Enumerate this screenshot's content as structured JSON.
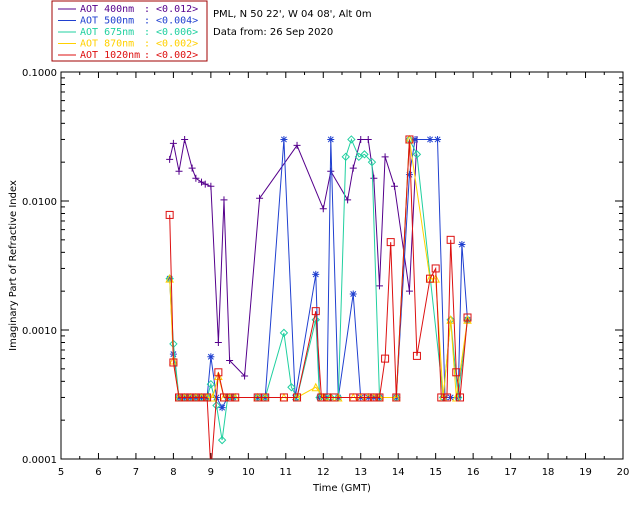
{
  "chart_data": {
    "type": "line",
    "header": {
      "site": "PML, N 50 22', W 04 08', Alt 0m",
      "date": "Data from: 26 Sep 2020"
    },
    "xlabel": "Time (GMT)",
    "ylabel": "Imaginary Part of Refractive Index",
    "x_range": [
      5,
      20
    ],
    "x_ticks": [
      "5",
      "6",
      "7",
      "8",
      "9",
      "10",
      "11",
      "12",
      "13",
      "14",
      "15",
      "16",
      "17",
      "18",
      "19",
      "20"
    ],
    "y_scale": "log",
    "y_range": [
      0.0001,
      0.1
    ],
    "y_ticks": [
      "0.1000",
      "0.0100",
      "0.0010",
      "0.0001"
    ],
    "y_tick_values": [
      0.1,
      0.01,
      0.001,
      0.0001
    ],
    "legend_position": "top-left",
    "series": [
      {
        "name": "AOT 400nm",
        "stat": ": <0.012>",
        "color": "#55008c",
        "marker": "plus",
        "points": [
          [
            7.9,
            0.021
          ],
          [
            8.0,
            0.028
          ],
          [
            8.15,
            0.017
          ],
          [
            8.3,
            0.03
          ],
          [
            8.5,
            0.018
          ],
          [
            8.6,
            0.015
          ],
          [
            8.75,
            0.014
          ],
          [
            8.85,
            0.0135
          ],
          [
            9.0,
            0.013
          ],
          [
            9.2,
            0.0008
          ],
          [
            9.35,
            0.0102
          ],
          [
            9.5,
            0.00058
          ],
          [
            9.9,
            0.00044
          ],
          [
            10.3,
            0.0105
          ],
          [
            11.3,
            0.027
          ],
          [
            12.0,
            0.0087
          ],
          [
            12.2,
            0.017
          ],
          [
            12.65,
            0.0102
          ],
          [
            12.8,
            0.018
          ],
          [
            13.0,
            0.03
          ],
          [
            13.2,
            0.03
          ],
          [
            13.35,
            0.015
          ],
          [
            13.5,
            0.0022
          ],
          [
            13.65,
            0.022
          ],
          [
            13.9,
            0.013
          ],
          [
            14.3,
            0.002
          ],
          [
            14.5,
            0.03
          ]
        ]
      },
      {
        "name": "AOT 500nm",
        "stat": ": <0.004>",
        "color": "#2040d0",
        "marker": "star",
        "points": [
          [
            7.9,
            0.0025
          ],
          [
            8.0,
            0.00065
          ],
          [
            8.15,
            0.0003
          ],
          [
            8.3,
            0.0003
          ],
          [
            8.45,
            0.0003
          ],
          [
            8.6,
            0.0003
          ],
          [
            8.75,
            0.0003
          ],
          [
            8.9,
            0.0003
          ],
          [
            9.0,
            0.00062
          ],
          [
            9.15,
            0.0003
          ],
          [
            9.3,
            0.00025
          ],
          [
            9.45,
            0.0003
          ],
          [
            9.6,
            0.0003
          ],
          [
            10.25,
            0.0003
          ],
          [
            10.45,
            0.0003
          ],
          [
            10.95,
            0.03
          ],
          [
            11.25,
            0.0003
          ],
          [
            11.8,
            0.0027
          ],
          [
            11.9,
            0.0003
          ],
          [
            12.1,
            0.0003
          ],
          [
            12.2,
            0.03
          ],
          [
            12.4,
            0.0003
          ],
          [
            12.8,
            0.0019
          ],
          [
            13.0,
            0.0003
          ],
          [
            13.2,
            0.0003
          ],
          [
            13.35,
            0.0003
          ],
          [
            13.5,
            0.0003
          ],
          [
            13.95,
            0.0003
          ],
          [
            14.3,
            0.016
          ],
          [
            14.45,
            0.03
          ],
          [
            14.85,
            0.03
          ],
          [
            15.05,
            0.03
          ],
          [
            15.25,
            0.0003
          ],
          [
            15.4,
            0.0003
          ],
          [
            15.6,
            0.0003
          ],
          [
            15.7,
            0.0046
          ],
          [
            15.85,
            0.0012
          ]
        ]
      },
      {
        "name": "AOT 675nm",
        "stat": ": <0.006>",
        "color": "#20d0a0",
        "marker": "diamond",
        "points": [
          [
            7.9,
            0.0025
          ],
          [
            8.0,
            0.00078
          ],
          [
            8.15,
            0.0003
          ],
          [
            8.3,
            0.0003
          ],
          [
            8.45,
            0.0003
          ],
          [
            8.6,
            0.0003
          ],
          [
            8.75,
            0.0003
          ],
          [
            8.9,
            0.0003
          ],
          [
            9.0,
            0.00038
          ],
          [
            9.15,
            0.00026
          ],
          [
            9.3,
            0.00014
          ],
          [
            9.45,
            0.0003
          ],
          [
            9.6,
            0.0003
          ],
          [
            10.25,
            0.0003
          ],
          [
            10.45,
            0.0003
          ],
          [
            10.95,
            0.00095
          ],
          [
            11.15,
            0.00036
          ],
          [
            11.3,
            0.0003
          ],
          [
            11.8,
            0.0012
          ],
          [
            11.9,
            0.0003
          ],
          [
            12.05,
            0.0003
          ],
          [
            12.2,
            0.0003
          ],
          [
            12.4,
            0.0003
          ],
          [
            12.6,
            0.022
          ],
          [
            12.75,
            0.03
          ],
          [
            12.95,
            0.022
          ],
          [
            13.1,
            0.023
          ],
          [
            13.3,
            0.02
          ],
          [
            13.5,
            0.0003
          ],
          [
            13.95,
            0.0003
          ],
          [
            14.3,
            0.03
          ],
          [
            14.5,
            0.023
          ],
          [
            15.2,
            0.0003
          ],
          [
            15.4,
            0.0012
          ],
          [
            15.6,
            0.0003
          ],
          [
            15.85,
            0.0012
          ]
        ]
      },
      {
        "name": "AOT 870nm",
        "stat": ": <0.002>",
        "color": "#ffd000",
        "marker": "triangle",
        "points": [
          [
            7.9,
            0.0025
          ],
          [
            8.0,
            0.00058
          ],
          [
            8.15,
            0.0003
          ],
          [
            8.3,
            0.0003
          ],
          [
            8.45,
            0.0003
          ],
          [
            8.6,
            0.0003
          ],
          [
            8.75,
            0.0003
          ],
          [
            8.9,
            0.0003
          ],
          [
            9.05,
            0.0003
          ],
          [
            9.2,
            0.00044
          ],
          [
            9.35,
            0.0003
          ],
          [
            9.5,
            0.0003
          ],
          [
            9.65,
            0.0003
          ],
          [
            10.25,
            0.0003
          ],
          [
            10.45,
            0.0003
          ],
          [
            10.95,
            0.0003
          ],
          [
            11.3,
            0.0003
          ],
          [
            11.8,
            0.00036
          ],
          [
            12.0,
            0.0003
          ],
          [
            12.2,
            0.0003
          ],
          [
            12.4,
            0.0003
          ],
          [
            12.8,
            0.0003
          ],
          [
            13.0,
            0.0003
          ],
          [
            13.2,
            0.0003
          ],
          [
            13.35,
            0.0003
          ],
          [
            13.5,
            0.0003
          ],
          [
            13.95,
            0.0003
          ],
          [
            14.3,
            0.03
          ],
          [
            14.85,
            0.0025
          ],
          [
            15.0,
            0.0025
          ],
          [
            15.2,
            0.0003
          ],
          [
            15.4,
            0.0012
          ],
          [
            15.55,
            0.0003
          ],
          [
            15.85,
            0.0012
          ]
        ]
      },
      {
        "name": "AOT 1020nm",
        "stat": ": <0.002>",
        "color": "#dd1010",
        "marker": "square",
        "points": [
          [
            7.9,
            0.0078
          ],
          [
            8.0,
            0.00056
          ],
          [
            8.15,
            0.0003
          ],
          [
            8.3,
            0.0003
          ],
          [
            8.45,
            0.0003
          ],
          [
            8.6,
            0.0003
          ],
          [
            8.75,
            0.0003
          ],
          [
            8.9,
            0.0003
          ],
          [
            9.0,
            8e-05
          ],
          [
            9.2,
            0.00047
          ],
          [
            9.35,
            0.0003
          ],
          [
            9.5,
            0.0003
          ],
          [
            9.65,
            0.0003
          ],
          [
            10.25,
            0.0003
          ],
          [
            10.45,
            0.0003
          ],
          [
            10.95,
            0.0003
          ],
          [
            11.3,
            0.0003
          ],
          [
            11.8,
            0.0014
          ],
          [
            11.95,
            0.0003
          ],
          [
            12.1,
            0.0003
          ],
          [
            12.3,
            0.0003
          ],
          [
            12.8,
            0.0003
          ],
          [
            13.0,
            0.0003
          ],
          [
            13.2,
            0.0003
          ],
          [
            13.35,
            0.0003
          ],
          [
            13.5,
            0.0003
          ],
          [
            13.65,
            0.0006
          ],
          [
            13.8,
            0.0048
          ],
          [
            13.95,
            0.0003
          ],
          [
            14.3,
            0.03
          ],
          [
            14.5,
            0.00063
          ],
          [
            14.85,
            0.0025
          ],
          [
            15.0,
            0.003
          ],
          [
            15.15,
            0.0003
          ],
          [
            15.3,
            0.0003
          ],
          [
            15.4,
            0.005
          ],
          [
            15.55,
            0.00047
          ],
          [
            15.65,
            0.0003
          ],
          [
            15.85,
            0.00125
          ]
        ]
      }
    ]
  }
}
